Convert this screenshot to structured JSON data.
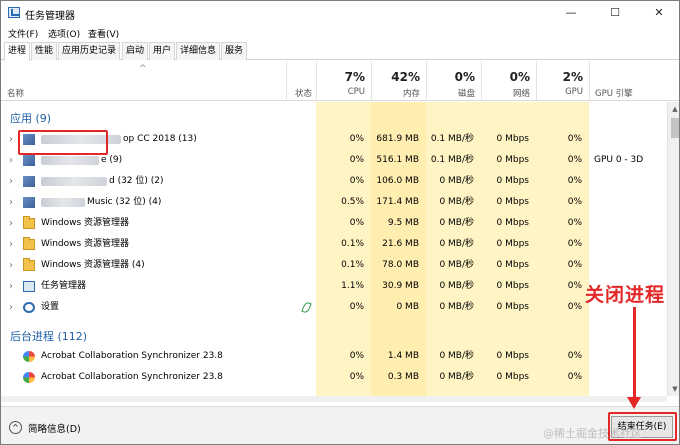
{
  "window": {
    "title": "任务管理器",
    "controls": {
      "minimize": "—",
      "maximize": "☐",
      "close": "✕"
    }
  },
  "menu": [
    "文件(F)",
    "选项(O)",
    "查看(V)"
  ],
  "tabs": [
    "进程",
    "性能",
    "应用历史记录",
    "启动",
    "用户",
    "详细信息",
    "服务"
  ],
  "header": {
    "name": "名称",
    "status": "状态",
    "cpu": {
      "pct": "7%",
      "label": "CPU"
    },
    "memory": {
      "pct": "42%",
      "label": "内存"
    },
    "disk": {
      "pct": "0%",
      "label": "磁盘"
    },
    "network": {
      "pct": "0%",
      "label": "网络"
    },
    "gpu": {
      "pct": "2%",
      "label": "GPU"
    },
    "gpu_engine": {
      "label": "GPU 引擎"
    }
  },
  "groups": {
    "apps": "应用 (9)",
    "background": "后台进程 (112)"
  },
  "apps": [
    {
      "name": "op CC 2018 (13)",
      "cpu": "0%",
      "mem": "681.9 MB",
      "disk": "0.1 MB/秒",
      "net": "0 Mbps",
      "gpu": "0%",
      "engine": "",
      "icon": "blurred-app-icon"
    },
    {
      "name": "e (9)",
      "cpu": "0%",
      "mem": "516.1 MB",
      "disk": "0.1 MB/秒",
      "net": "0 Mbps",
      "gpu": "0%",
      "engine": "GPU 0 - 3D",
      "icon": "blurred-app-icon"
    },
    {
      "name": "d (32 位) (2)",
      "cpu": "0%",
      "mem": "106.0 MB",
      "disk": "0 MB/秒",
      "net": "0 Mbps",
      "gpu": "0%",
      "engine": "",
      "icon": "blurred-app-icon"
    },
    {
      "name": "Music (32 位) (4)",
      "cpu": "0.5%",
      "mem": "171.4 MB",
      "disk": "0 MB/秒",
      "net": "0 Mbps",
      "gpu": "0%",
      "engine": "",
      "icon": "blurred-app-icon"
    },
    {
      "name": "Windows 资源管理器",
      "cpu": "0%",
      "mem": "9.5 MB",
      "disk": "0 MB/秒",
      "net": "0 Mbps",
      "gpu": "0%",
      "engine": "",
      "icon": "folder-icon"
    },
    {
      "name": "Windows 资源管理器",
      "cpu": "0.1%",
      "mem": "21.6 MB",
      "disk": "0 MB/秒",
      "net": "0 Mbps",
      "gpu": "0%",
      "engine": "",
      "icon": "folder-icon"
    },
    {
      "name": "Windows 资源管理器 (4)",
      "cpu": "0.1%",
      "mem": "78.0 MB",
      "disk": "0 MB/秒",
      "net": "0 Mbps",
      "gpu": "0%",
      "engine": "",
      "icon": "folder-icon"
    },
    {
      "name": "任务管理器",
      "cpu": "1.1%",
      "mem": "30.9 MB",
      "disk": "0 MB/秒",
      "net": "0 Mbps",
      "gpu": "0%",
      "engine": "",
      "icon": "task-manager-icon"
    },
    {
      "name": "设置",
      "cpu": "0%",
      "mem": "0 MB",
      "disk": "0 MB/秒",
      "net": "0 Mbps",
      "gpu": "0%",
      "engine": "",
      "icon": "settings-gear-icon"
    }
  ],
  "background": [
    {
      "name": "Acrobat Collaboration Synchronizer 23.8",
      "cpu": "0%",
      "mem": "1.4 MB",
      "disk": "0 MB/秒",
      "net": "0 Mbps",
      "gpu": "0%",
      "engine": "",
      "icon": "acrobat-icon"
    },
    {
      "name": "Acrobat Collaboration Synchronizer 23.8",
      "cpu": "0%",
      "mem": "0.3 MB",
      "disk": "0 MB/秒",
      "net": "0 Mbps",
      "gpu": "0%",
      "engine": "",
      "icon": "acrobat-icon"
    }
  ],
  "footer": {
    "fewer_details": "简略信息(D)",
    "end_task": "结束任务(E)"
  },
  "annotation": {
    "text": "关闭进程",
    "color": "#e32626"
  },
  "watermark": "@稀土掘金技术社区"
}
